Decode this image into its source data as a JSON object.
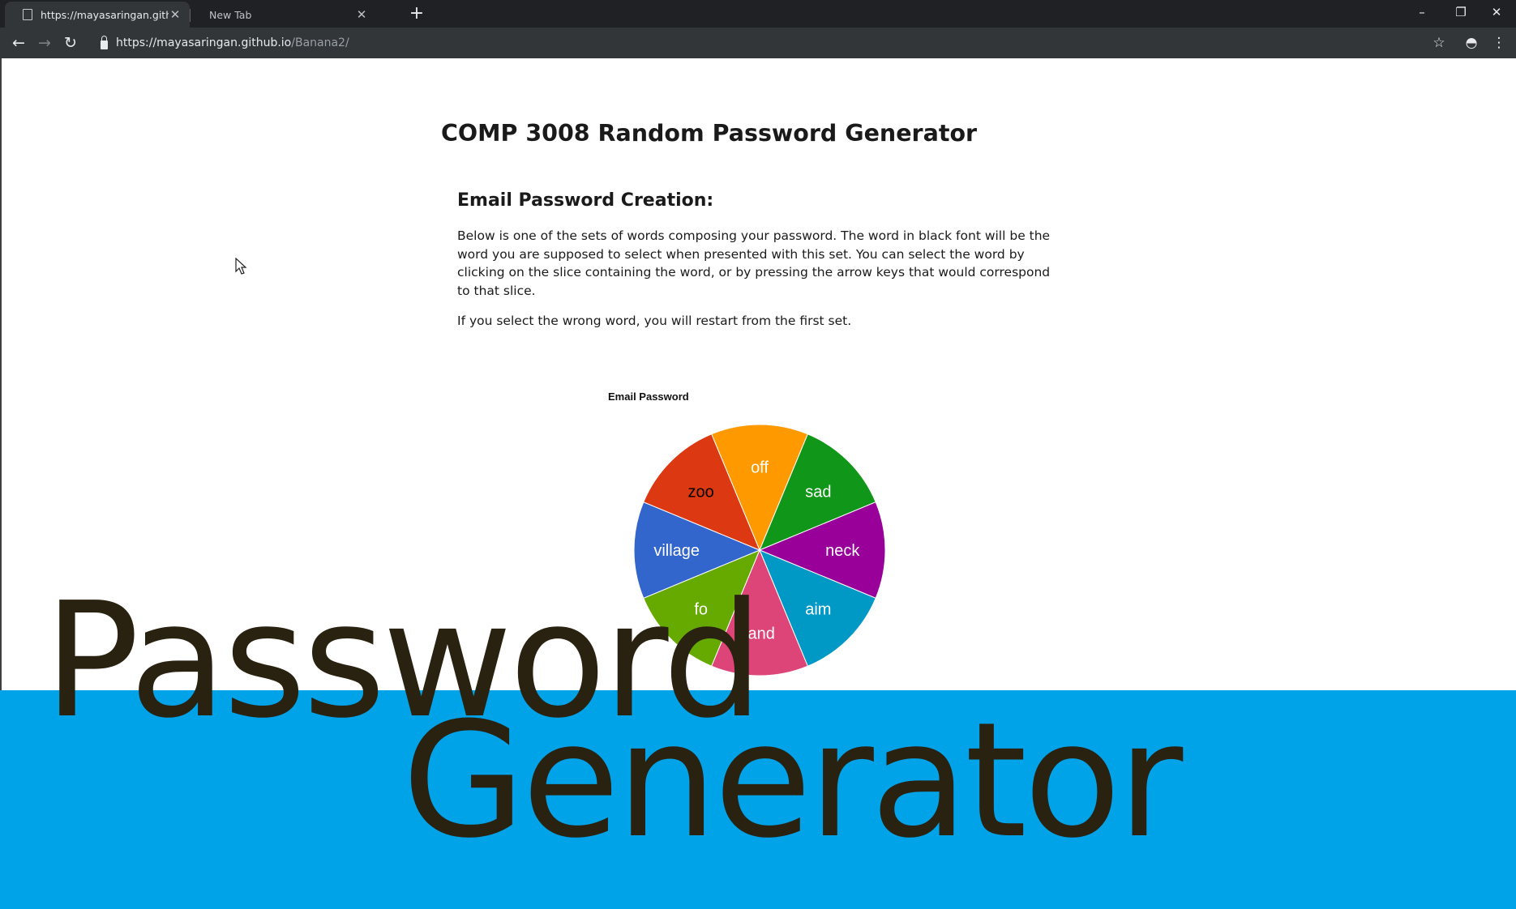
{
  "browser": {
    "tabs": [
      {
        "title": "https://mayasaringan.github.io/B",
        "active": true
      },
      {
        "title": "New Tab",
        "active": false
      }
    ],
    "url_host": "https://mayasaringan.github.io",
    "url_path": "/Banana2/",
    "icons": {
      "back": "arrow-left-icon",
      "forward": "arrow-right-icon",
      "reload": "reload-icon",
      "lock": "lock-icon",
      "bookmark": "star-icon",
      "incognito": "incognito-icon",
      "menu": "kebab-menu-icon",
      "new_tab": "plus-icon"
    }
  },
  "page": {
    "title": "COMP 3008 Random Password Generator",
    "section_title": "Email Password Creation:",
    "paragraph_1": "Below is one of the sets of words composing your password. The word in black font will be the word you are supposed to select when presented with this set. You can select the word by clicking on the slice containing the word, or by pressing the arrow keys that would correspond to that slice.",
    "paragraph_2": "If you select the wrong word, you will restart from the first set."
  },
  "chart_data": {
    "type": "pie",
    "title": "Email Password",
    "slices": [
      {
        "label": "off",
        "value": 1,
        "color": "#ff9900",
        "text_color": "#ffffff"
      },
      {
        "label": "sad",
        "value": 1,
        "color": "#109618",
        "text_color": "#ffffff"
      },
      {
        "label": "neck",
        "value": 1,
        "color": "#990099",
        "text_color": "#ffffff"
      },
      {
        "label": "aim",
        "value": 1,
        "color": "#0099c6",
        "text_color": "#ffffff"
      },
      {
        "label": "land",
        "value": 1,
        "color": "#dd4477",
        "text_color": "#ffffff"
      },
      {
        "label": "fo",
        "value": 1,
        "color": "#66aa00",
        "text_color": "#ffffff"
      },
      {
        "label": "village",
        "value": 1,
        "color": "#3366cc",
        "text_color": "#ffffff"
      },
      {
        "label": "zoo",
        "value": 1,
        "color": "#dc3912",
        "text_color": "#000000"
      }
    ]
  },
  "overlay": {
    "line_1": "Password",
    "line_2": "Generator",
    "banner_color": "#00a2e8",
    "text_color": "#2a2211"
  }
}
